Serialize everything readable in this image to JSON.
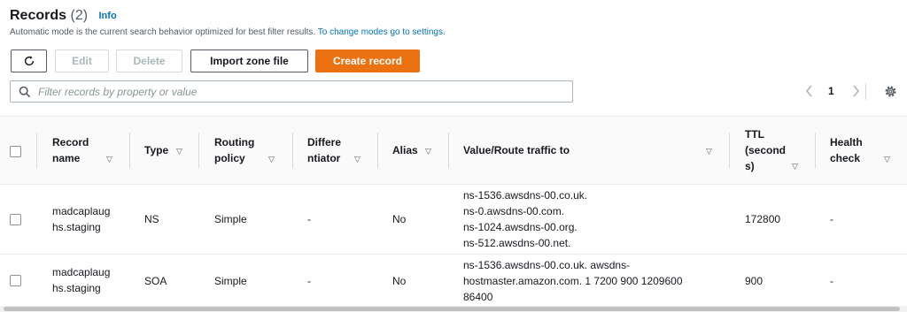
{
  "header": {
    "title": "Records",
    "count": "(2)",
    "info": "Info",
    "subtitle": "Automatic mode is the current search behavior optimized for best filter results.",
    "subtitle_link": "To change modes go to settings."
  },
  "toolbar": {
    "refresh_icon": "refresh-icon",
    "edit_label": "Edit",
    "delete_label": "Delete",
    "import_label": "Import zone file",
    "create_label": "Create record",
    "primary_color": "#ec7211"
  },
  "search": {
    "placeholder": "Filter records by property or value"
  },
  "pagination": {
    "prev_icon": "chevron-left-icon",
    "page": "1",
    "next_icon": "chevron-right-icon",
    "settings_icon": "gear-icon"
  },
  "table": {
    "headers": [
      {
        "line1": "Record",
        "line2": "name"
      },
      {
        "line1": "Type",
        "line2": ""
      },
      {
        "line1": "Routing",
        "line2": "policy"
      },
      {
        "line1": "Differe",
        "line2": "ntiator"
      },
      {
        "line1": "Alias",
        "line2": ""
      },
      {
        "line1": "Value/Route traffic to",
        "line2": ""
      },
      {
        "line1": "TTL",
        "line2": "(second",
        "line3": "s)"
      },
      {
        "line1": "Health",
        "line2": "check"
      }
    ],
    "rows": [
      {
        "name1": "madcaplaug",
        "name2": "hs.staging",
        "type": "NS",
        "routing": "Simple",
        "differentiator": "-",
        "alias": "No",
        "value": [
          "ns-1536.awsdns-00.co.uk.",
          "ns-0.awsdns-00.com.",
          "ns-1024.awsdns-00.org.",
          "ns-512.awsdns-00.net."
        ],
        "ttl": "172800",
        "health": "-"
      },
      {
        "name1": "madcaplaug",
        "name2": "hs.staging",
        "type": "SOA",
        "routing": "Simple",
        "differentiator": "-",
        "alias": "No",
        "value": [
          "ns-1536.awsdns-00.co.uk. awsdns-",
          "hostmaster.amazon.com. 1 7200 900 1209600",
          "86400"
        ],
        "ttl": "900",
        "health": "-"
      }
    ]
  }
}
